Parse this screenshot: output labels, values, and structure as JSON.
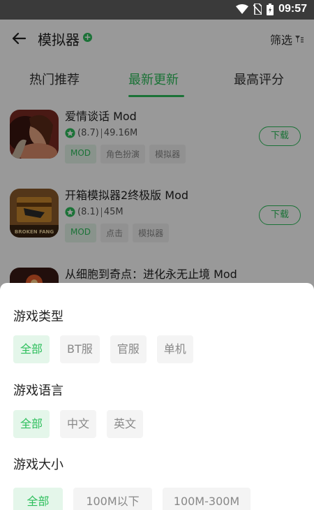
{
  "status_bar": {
    "time": "09:57"
  },
  "header": {
    "title": "模拟器",
    "filter_label": "筛选"
  },
  "tabs": [
    {
      "label": "热门推荐",
      "active": false
    },
    {
      "label": "最新更新",
      "active": true
    },
    {
      "label": "最高评分",
      "active": false
    }
  ],
  "apps": [
    {
      "name": "爱情谈话 Mod",
      "rating": "(8.7)",
      "size": "49.16M",
      "tags": [
        "MOD",
        "角色扮演",
        "模拟器"
      ],
      "download_label": "下载"
    },
    {
      "name": "开箱模拟器2终极版 Mod",
      "rating": "(8.1)",
      "size": "45M",
      "tags": [
        "MOD",
        "点击",
        "模拟器"
      ],
      "download_label": "下载",
      "icon_text": "BROKEN FANG"
    },
    {
      "name": "从细胞到奇点：进化永无止境 Mod"
    }
  ],
  "filter_sheet": {
    "game_type": {
      "title": "游戏类型",
      "options": [
        "全部",
        "BT服",
        "官服",
        "单机"
      ]
    },
    "game_language": {
      "title": "游戏语言",
      "options": [
        "全部",
        "中文",
        "英文"
      ]
    },
    "game_size": {
      "title": "游戏大小",
      "options": [
        "全部",
        "100M以下",
        "100M-300M"
      ]
    }
  },
  "colors": {
    "accent": "#2dbf5c",
    "chip_bg": "#f4f4f4",
    "chip_active_bg": "#e4f6ea",
    "status_bar": "#3a3a3a"
  }
}
